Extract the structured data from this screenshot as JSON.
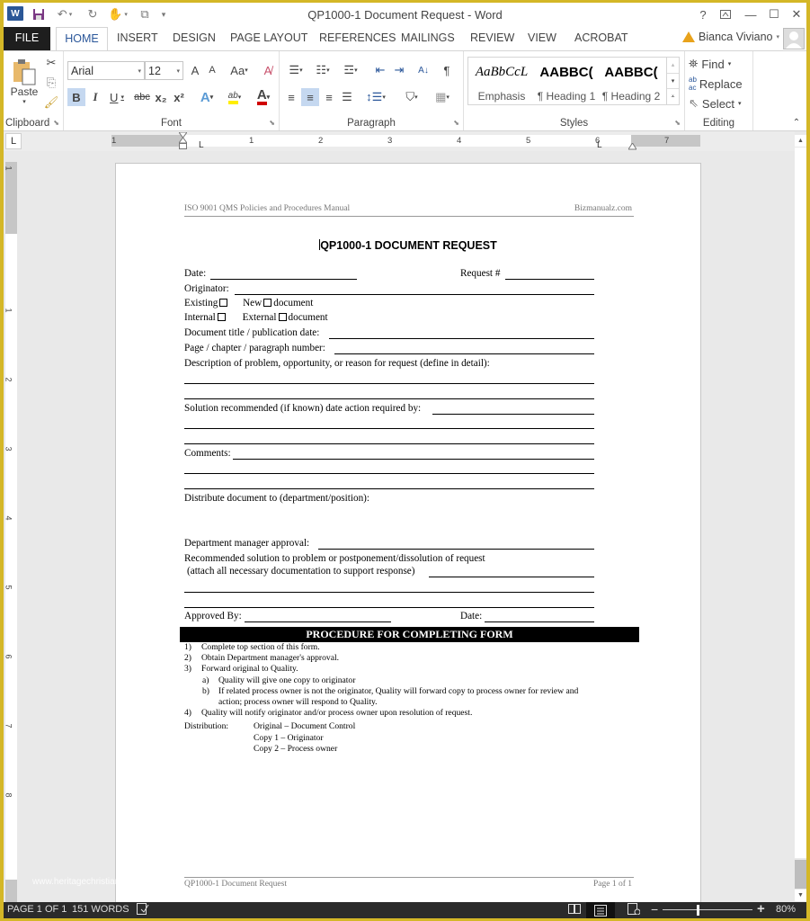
{
  "window": {
    "title": "QP1000-1 Document Request - Word",
    "help": "?",
    "controls": [
      "ribbon-display",
      "minimize",
      "maximize",
      "close"
    ]
  },
  "quick_access": {
    "icons": [
      "word-logo-icon",
      "save-icon",
      "undo-icon",
      "redo-icon",
      "touch-mode-icon",
      "customize-icon"
    ],
    "logo_text": "W"
  },
  "tabs": [
    "FILE",
    "HOME",
    "INSERT",
    "DESIGN",
    "PAGE LAYOUT",
    "REFERENCES",
    "MAILINGS",
    "REVIEW",
    "VIEW",
    "ACROBAT"
  ],
  "active_tab": "HOME",
  "user": {
    "name": "Bianca Viviano",
    "warning": "!"
  },
  "ribbon": {
    "clipboard": {
      "label": "Clipboard",
      "paste": "Paste"
    },
    "font": {
      "label": "Font",
      "font_name": "Arial",
      "font_size": "12",
      "grow": "A",
      "shrink": "A",
      "change_case": "Aa",
      "bold": "B",
      "italic": "I",
      "underline": "U",
      "strike": "abc",
      "subscript": "x₂",
      "superscript": "x²",
      "text_effects": "A",
      "highlight": "ab",
      "font_color": "A"
    },
    "paragraph": {
      "label": "Paragraph",
      "pilcrow": "¶",
      "sort": "A↓"
    },
    "styles": {
      "label": "Styles",
      "items": [
        {
          "preview": "AaBbCcL",
          "name": "Emphasis"
        },
        {
          "preview": "AABBC(",
          "name": "¶ Heading 1"
        },
        {
          "preview": "AABBC(",
          "name": "¶ Heading 2"
        }
      ]
    },
    "editing": {
      "label": "Editing",
      "find": "Find",
      "replace": "Replace",
      "select": "Select"
    }
  },
  "ruler": {
    "tab_selector": "L",
    "h_numbers": [
      "1",
      "1",
      "2",
      "3",
      "4",
      "5",
      "6",
      "7"
    ],
    "v_numbers": [
      "1",
      "1",
      "2",
      "3",
      "4",
      "5",
      "6",
      "7",
      "8"
    ]
  },
  "document": {
    "header_left": "ISO 9001 QMS Policies and Procedures Manual",
    "header_right": "Bizmanualz.com",
    "title": "QP1000-1 DOCUMENT REQUEST",
    "form": {
      "date": "Date:",
      "request": "Request #",
      "originator": "Originator:",
      "existing": "Existing",
      "new": "New",
      "document": "document",
      "internal": "Internal",
      "external": "External",
      "doc_title": "Document title / publication date:",
      "page_chapter": "Page / chapter / paragraph number:",
      "description": "Description of problem, opportunity, or reason for request (define in detail):",
      "solution": "Solution recommended (if known) date action required by:",
      "comments": "Comments:",
      "distribute": "Distribute document to (department/position):",
      "dept_approval": "Department manager approval:",
      "recommended": "Recommended solution to problem or postponement/dissolution of request",
      "attach": "(attach all necessary documentation to support response)",
      "approved_by": "Approved By:",
      "approved_date": "Date:"
    },
    "procedure": {
      "heading": "PROCEDURE FOR COMPLETING FORM",
      "steps": [
        {
          "num": "1)",
          "text": "Complete top section of this form."
        },
        {
          "num": "2)",
          "text": "Obtain Department manager's approval."
        },
        {
          "num": "3)",
          "text": "Forward original to Quality."
        },
        {
          "num": "a)",
          "text": "Quality will give one copy to originator"
        },
        {
          "num": "b)",
          "text": "If related process owner is not the originator, Quality will forward copy to process owner for review and",
          "cont": "action; process owner will respond to Quality."
        },
        {
          "num": "4)",
          "text": "Quality will notify originator and/or process owner upon resolution of request."
        }
      ],
      "distribution_label": "Distribution:",
      "distribution": [
        "Original – Document Control",
        "Copy 1 – Originator",
        "Copy 2 – Process owner"
      ]
    },
    "footer_left": "QP1000-1 Document Request",
    "footer_right": "Page 1 of 1"
  },
  "watermark": "www.heritagechristiancollege.com",
  "status": {
    "page": "PAGE 1 OF 1",
    "words": "151 WORDS",
    "zoom": "80%",
    "zoom_value_percent": 80,
    "views": [
      "read-mode",
      "print-layout",
      "web-layout"
    ],
    "active_view": "print-layout"
  }
}
